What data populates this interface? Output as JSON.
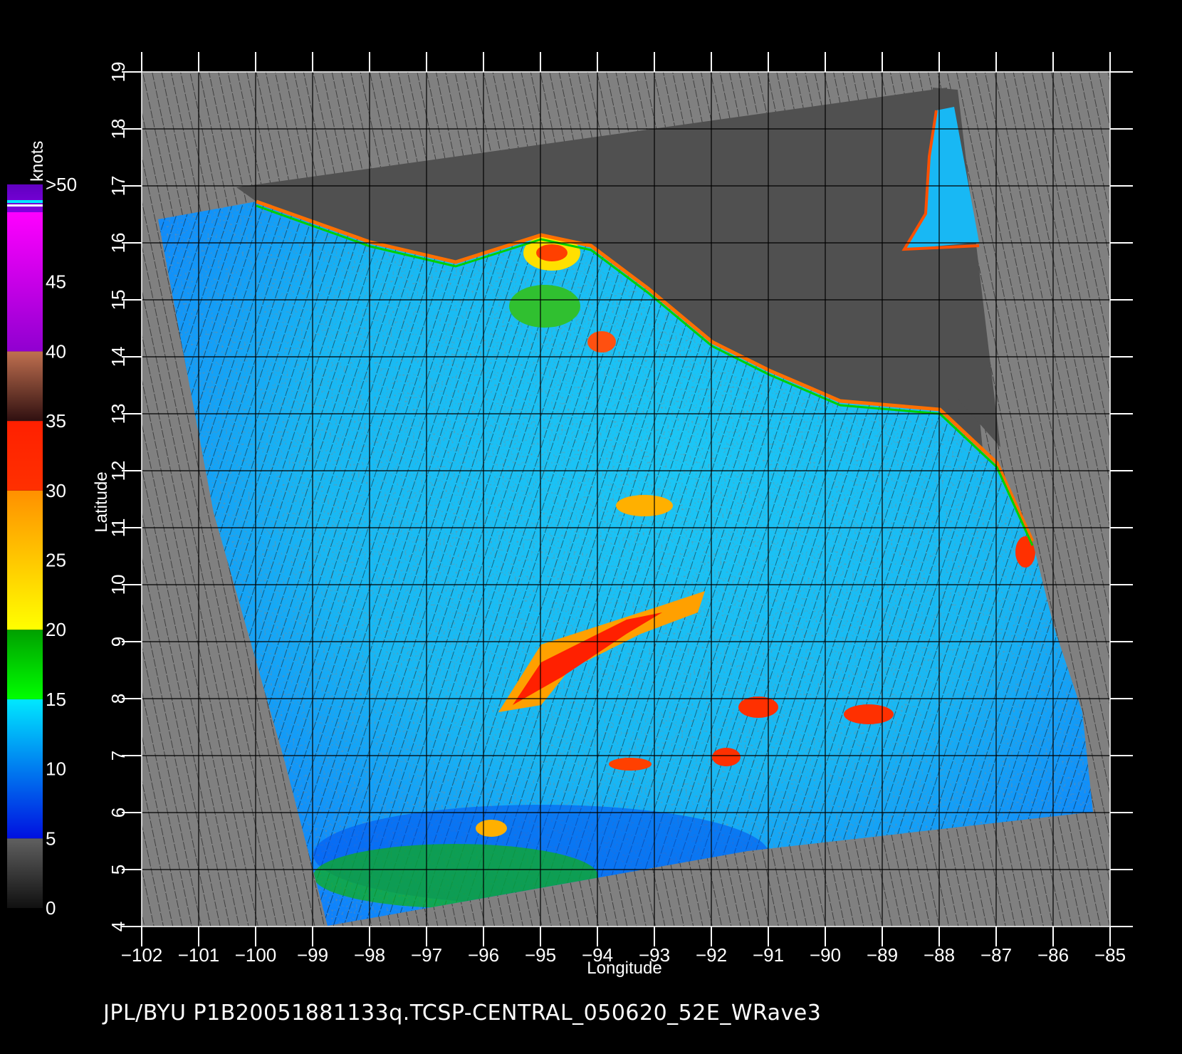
{
  "colorbar": {
    "unit": "knots",
    "labels": [
      ">50",
      "45",
      "40",
      "35",
      "30",
      "25",
      "20",
      "15",
      "10",
      "5",
      "0"
    ],
    "bands": [
      {
        "from": 0,
        "to": 5,
        "top": "#606060",
        "bottom": "#101010",
        "label": "0-5"
      },
      {
        "from": 5,
        "to": 15,
        "top": "#00e8ff",
        "bottom": "#0010e0",
        "label": "5-15"
      },
      {
        "from": 15,
        "to": 20,
        "top": "#00a000",
        "bottom": "#00ff00",
        "label": "15-20"
      },
      {
        "from": 20,
        "to": 30,
        "top": "#ff9000",
        "bottom": "#ffff00",
        "label": "20-30"
      },
      {
        "from": 30,
        "to": 35,
        "top": "#ff2000",
        "bottom": "#ff3000",
        "label": "30-35"
      },
      {
        "from": 35,
        "to": 40,
        "top": "#c07050",
        "bottom": "#301010",
        "label": "35-40"
      },
      {
        "from": 40,
        "to": 50,
        "top": "#ff00ff",
        "bottom": "#9000d0",
        "label": "40-50"
      },
      {
        "from": 50,
        "to": 55,
        "top": "#6000c0",
        "bottom": "#8000e0",
        "label": ">50"
      }
    ]
  },
  "axes": {
    "x_title": "Longitude",
    "y_title": "Latitude",
    "x_ticks": [
      "−102",
      "−101",
      "−100",
      "−99",
      "−98",
      "−97",
      "−96",
      "−95",
      "−94",
      "−93",
      "−92",
      "−91",
      "−90",
      "−89",
      "−88",
      "−87",
      "−86",
      "−85"
    ],
    "y_ticks": [
      "4",
      "5",
      "6",
      "7",
      "8",
      "9",
      "10",
      "11",
      "12",
      "13",
      "14",
      "15",
      "16",
      "17",
      "18",
      "19"
    ],
    "lon_range": [
      -102,
      -85
    ],
    "lat_range": [
      4,
      19
    ],
    "grid": true
  },
  "footer": "JPL/BYU  P1B20051881133q.TCSP-CENTRAL_050620_52E_WRave3",
  "colors": {
    "background": "#000000",
    "land": "#505050",
    "no_data": "#808080",
    "ocean_low": "#0a6cff",
    "ocean_mid": "#18c8f8",
    "grid": "#000000"
  }
}
